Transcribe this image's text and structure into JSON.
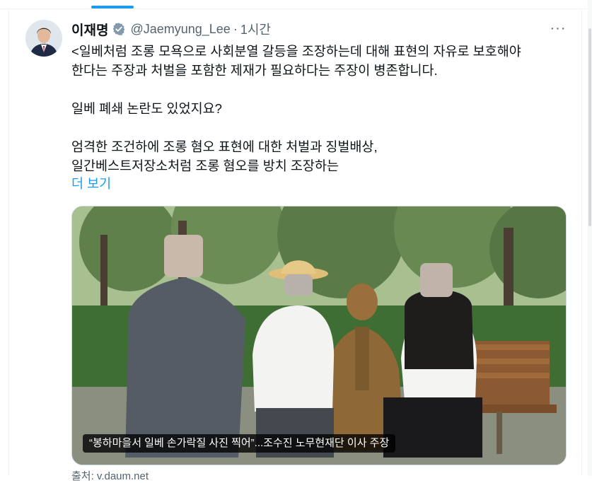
{
  "tweet": {
    "author_name": "이재명",
    "handle": "@Jaemyung_Lee",
    "separator": "·",
    "time": "1시간",
    "more_label": "···",
    "text_lines": [
      "<일베처럼 조롱 모욕으로 사회분열 갈등을 조장하는데 대해 표현의 자유로 보호해야",
      "한다는 주장과 처벌을 포함한 제재가 필요하다는 주장이 병존합니다.",
      "",
      "일베 폐쇄 논란도 있었지요?",
      "",
      "엄격한 조건하에 조롱 혐오 표현에 대한 처벌과 징벌배상,",
      "일간베스트저장소처럼 조롱 혐오를 방치 조장하는"
    ],
    "show_more": "더 보기",
    "media_caption": "“봉하마을서 일베 손가락질 사진 찍어”...조수진 노무현재단 이사 주장",
    "source": "출처: v.daum.net"
  },
  "colors": {
    "accent": "#1d9bf0",
    "secondary_text": "#536471",
    "primary_text": "#0f1419",
    "verified_badge": "#829aab"
  },
  "icons": {
    "verified": "verified-badge-icon",
    "more": "more-options-icon"
  }
}
